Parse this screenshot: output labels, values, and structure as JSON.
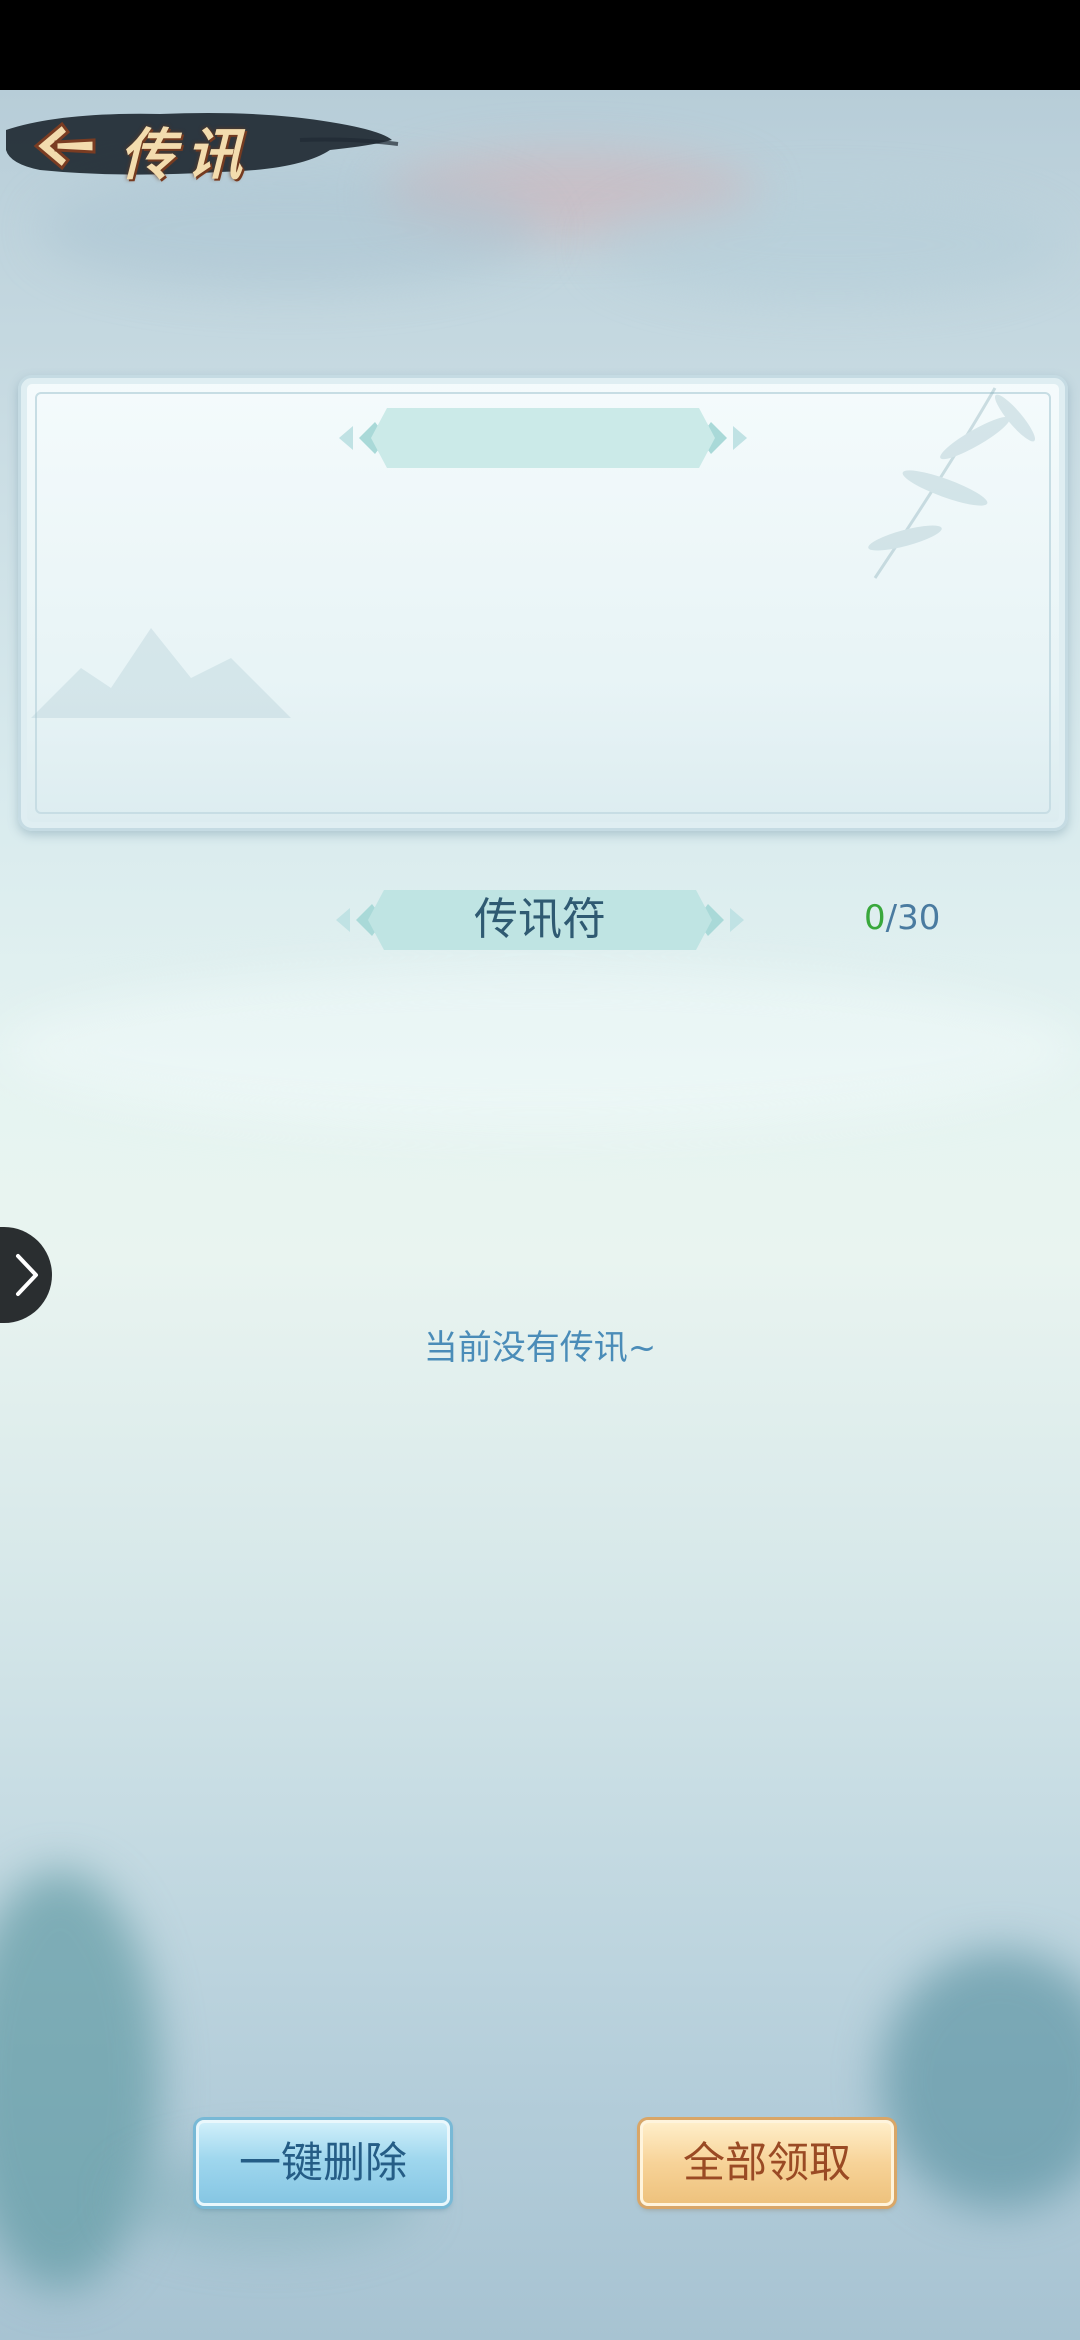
{
  "header": {
    "title": "传讯"
  },
  "message_section": {
    "title": "传讯符",
    "count": "0",
    "capacity": "/30",
    "empty_text": "当前没有传讯~"
  },
  "actions": {
    "delete_all_label": "一键删除",
    "claim_all_label": "全部领取"
  },
  "colors": {
    "title_text": "#2f5a72",
    "count_current": "#39a83c",
    "count_total": "#4a7ba0",
    "empty_text": "#4a8cb8",
    "delete_button": "#9fd7ee",
    "claim_button": "#f7d398"
  },
  "icons": {
    "back": "back-arrow-icon",
    "side": "chevron-right-icon"
  }
}
